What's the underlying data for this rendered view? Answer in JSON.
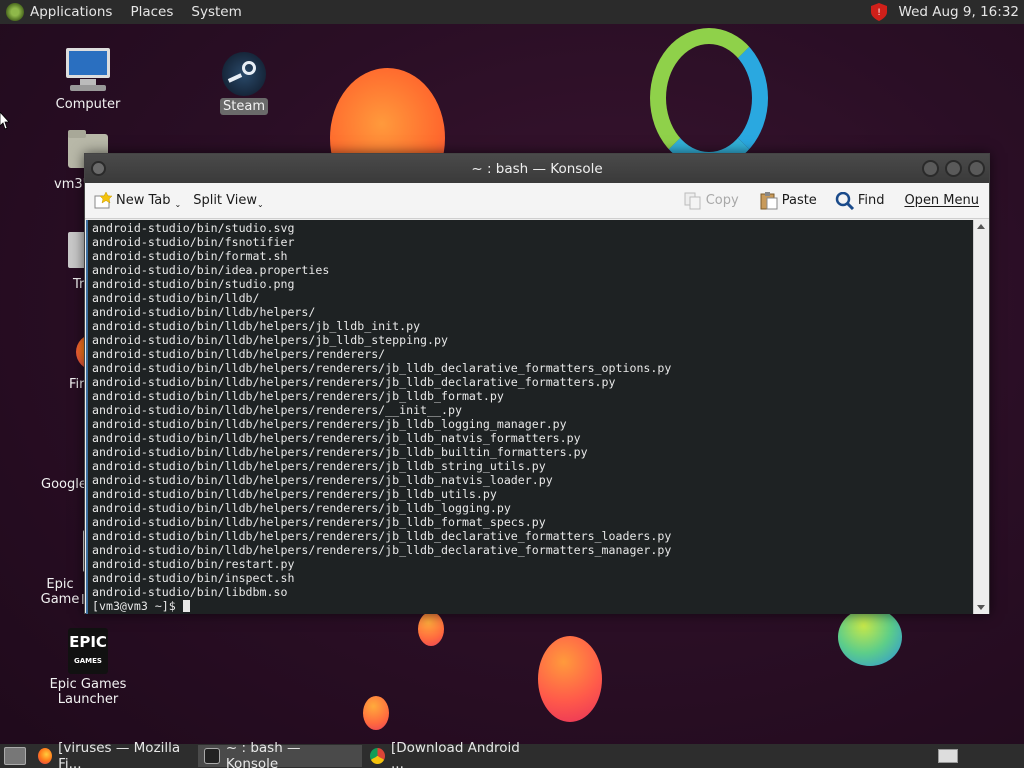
{
  "panel": {
    "menus": [
      "Applications",
      "Places",
      "System"
    ],
    "clock": "Wed Aug  9, 16:32"
  },
  "desktop": {
    "icons": [
      {
        "label": "Computer",
        "icon": "computer-icon"
      },
      {
        "label": "Steam",
        "icon": "steam-icon"
      },
      {
        "label": "vm3's",
        "icon": "home-folder-icon"
      },
      {
        "label": "Tr",
        "icon": "trash-icon"
      },
      {
        "label": "Fir",
        "icon": "firefox-icon"
      },
      {
        "label": "Google",
        "icon": "chrome-icon"
      },
      {
        "label": "Epic Game",
        "label2": "l",
        "icon": "epic-games-icon"
      },
      {
        "label": "Epic Games Launcher",
        "icon": "epic-games-launcher-icon"
      }
    ]
  },
  "window": {
    "title": "~ : bash — Konsole",
    "toolbar": {
      "new_tab": "New Tab",
      "split_view": "Split View",
      "copy": "Copy",
      "paste": "Paste",
      "find": "Find",
      "open_menu": "Open Menu"
    },
    "terminal": {
      "lines": [
        "android-studio/bin/studio.svg",
        "android-studio/bin/fsnotifier",
        "android-studio/bin/format.sh",
        "android-studio/bin/idea.properties",
        "android-studio/bin/studio.png",
        "android-studio/bin/lldb/",
        "android-studio/bin/lldb/helpers/",
        "android-studio/bin/lldb/helpers/jb_lldb_init.py",
        "android-studio/bin/lldb/helpers/jb_lldb_stepping.py",
        "android-studio/bin/lldb/helpers/renderers/",
        "android-studio/bin/lldb/helpers/renderers/jb_lldb_declarative_formatters_options.py",
        "android-studio/bin/lldb/helpers/renderers/jb_lldb_declarative_formatters.py",
        "android-studio/bin/lldb/helpers/renderers/jb_lldb_format.py",
        "android-studio/bin/lldb/helpers/renderers/__init__.py",
        "android-studio/bin/lldb/helpers/renderers/jb_lldb_logging_manager.py",
        "android-studio/bin/lldb/helpers/renderers/jb_lldb_natvis_formatters.py",
        "android-studio/bin/lldb/helpers/renderers/jb_lldb_builtin_formatters.py",
        "android-studio/bin/lldb/helpers/renderers/jb_lldb_string_utils.py",
        "android-studio/bin/lldb/helpers/renderers/jb_lldb_natvis_loader.py",
        "android-studio/bin/lldb/helpers/renderers/jb_lldb_utils.py",
        "android-studio/bin/lldb/helpers/renderers/jb_lldb_logging.py",
        "android-studio/bin/lldb/helpers/renderers/jb_lldb_format_specs.py",
        "android-studio/bin/lldb/helpers/renderers/jb_lldb_declarative_formatters_loaders.py",
        "android-studio/bin/lldb/helpers/renderers/jb_lldb_declarative_formatters_manager.py",
        "android-studio/bin/restart.py",
        "android-studio/bin/inspect.sh",
        "android-studio/bin/libdbm.so"
      ],
      "prompt": "[vm3@vm3 ~]$ "
    }
  },
  "taskbar": {
    "tasks": [
      {
        "label": "[viruses — Mozilla Fi...",
        "icon": "firefox-icon"
      },
      {
        "label": "~ : bash — Konsole",
        "icon": "terminal-icon"
      },
      {
        "label": "[Download Android ...",
        "icon": "chrome-icon"
      }
    ]
  }
}
